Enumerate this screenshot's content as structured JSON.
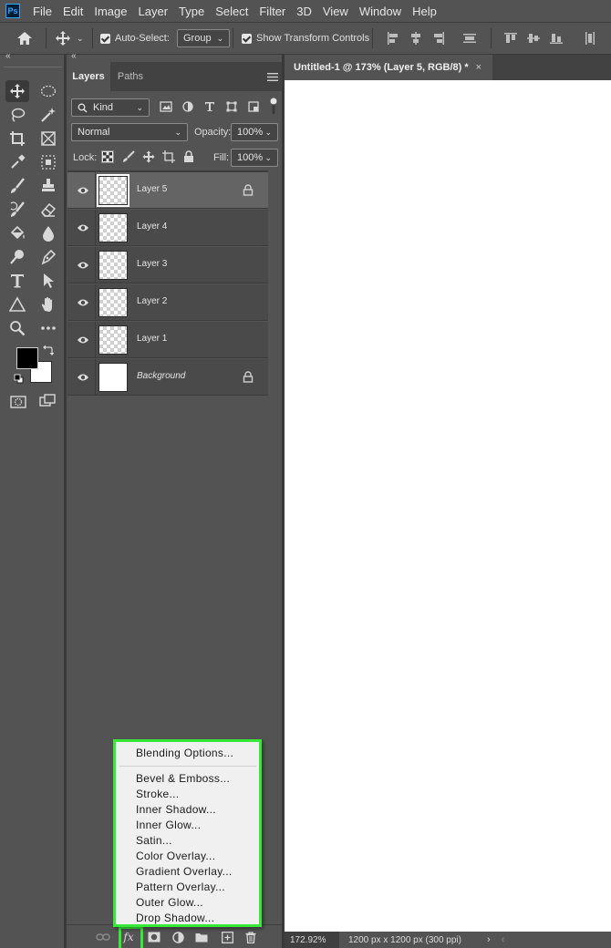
{
  "app": {
    "logo_text": "Ps"
  },
  "menubar": {
    "items": [
      "File",
      "Edit",
      "Image",
      "Layer",
      "Type",
      "Select",
      "Filter",
      "3D",
      "View",
      "Window",
      "Help"
    ]
  },
  "options_bar": {
    "auto_select_label": "Auto-Select:",
    "auto_select_value": "Group",
    "show_transform_label": "Show Transform Controls"
  },
  "layers_panel": {
    "tabs": [
      "Layers",
      "Paths"
    ],
    "filter_kind": "Kind",
    "blend_mode": "Normal",
    "opacity_label": "Opacity:",
    "opacity_value": "100%",
    "lock_label": "Lock:",
    "fill_label": "Fill:",
    "fill_value": "100%",
    "layers": [
      {
        "name": "Layer 5",
        "selected": true,
        "locked": true
      },
      {
        "name": "Layer 4"
      },
      {
        "name": "Layer 3"
      },
      {
        "name": "Layer 2"
      },
      {
        "name": "Layer 1"
      },
      {
        "name": "Background",
        "locked": true
      }
    ]
  },
  "context_menu": {
    "items": [
      "Blending Options...",
      "Bevel & Emboss...",
      "Stroke...",
      "Inner Shadow...",
      "Inner Glow...",
      "Satin...",
      "Color Overlay...",
      "Gradient Overlay...",
      "Pattern Overlay...",
      "Outer Glow...",
      "Drop Shadow..."
    ]
  },
  "document": {
    "tab_title": "Untitled-1 @ 173% (Layer 5, RGB/8) *",
    "close_glyph": "×",
    "zoom": "172.92%",
    "doc_info": "1200 px x 1200 px (300 ppi)"
  },
  "footer": {
    "fx_label": "fx"
  },
  "colors": {
    "highlight": "#38e838",
    "panel_bg": "#535353",
    "dark_bg": "#424242"
  }
}
